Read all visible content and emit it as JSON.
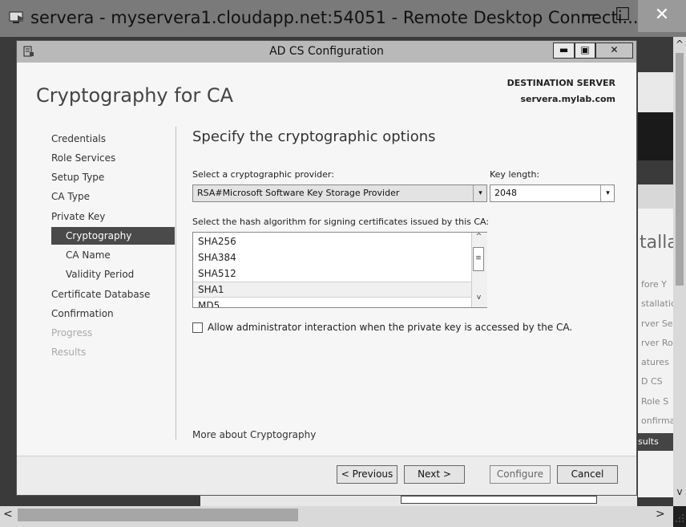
{
  "rdp": {
    "title": "servera - myservera1.cloudapp.net:54051 - Remote Desktop Connecti...",
    "min": "—",
    "max": "☐",
    "close": "✕"
  },
  "background": {
    "installa": "talla",
    "lines": [
      "fore Y",
      "stallatic",
      "rver Se",
      "rver Ro",
      "atures",
      "D CS",
      "Role S",
      "onfirma"
    ],
    "results": "sults"
  },
  "dialog": {
    "title": "AD CS Configuration",
    "min": "▬",
    "max": "▣",
    "close": "✕",
    "page_title": "Cryptography for CA",
    "destination_label": "DESTINATION SERVER",
    "destination_server": "servera.mylab.com"
  },
  "nav": [
    {
      "label": "Credentials"
    },
    {
      "label": "Role Services"
    },
    {
      "label": "Setup Type"
    },
    {
      "label": "CA Type"
    },
    {
      "label": "Private Key"
    },
    {
      "label": "Cryptography"
    },
    {
      "label": "CA Name"
    },
    {
      "label": "Validity Period"
    },
    {
      "label": "Certificate Database"
    },
    {
      "label": "Confirmation"
    },
    {
      "label": "Progress"
    },
    {
      "label": "Results"
    }
  ],
  "main": {
    "heading": "Specify the cryptographic options",
    "provider_label": "Select a cryptographic provider:",
    "provider_value": "RSA#Microsoft Software Key Storage Provider",
    "keylen_label": "Key length:",
    "keylen_value": "2048",
    "hash_label": "Select the hash algorithm for signing certificates issued by this CA:",
    "hash_items": [
      "SHA256",
      "SHA384",
      "SHA512",
      "SHA1",
      "MD5"
    ],
    "hash_selected": "SHA1",
    "allow_label": "Allow administrator interaction when the private key is accessed by the CA.",
    "more_link": "More about Cryptography"
  },
  "footer": {
    "previous": "< Previous",
    "next": "Next >",
    "configure": "Configure",
    "cancel": "Cancel"
  },
  "icons": {
    "dropdown": "▾",
    "scroll_up": "^",
    "scroll_down": "v",
    "thumb": "≡",
    "hscroll_left": "<",
    "hscroll_right": ">",
    "vscroll_up": "^",
    "vscroll_down": "v"
  }
}
